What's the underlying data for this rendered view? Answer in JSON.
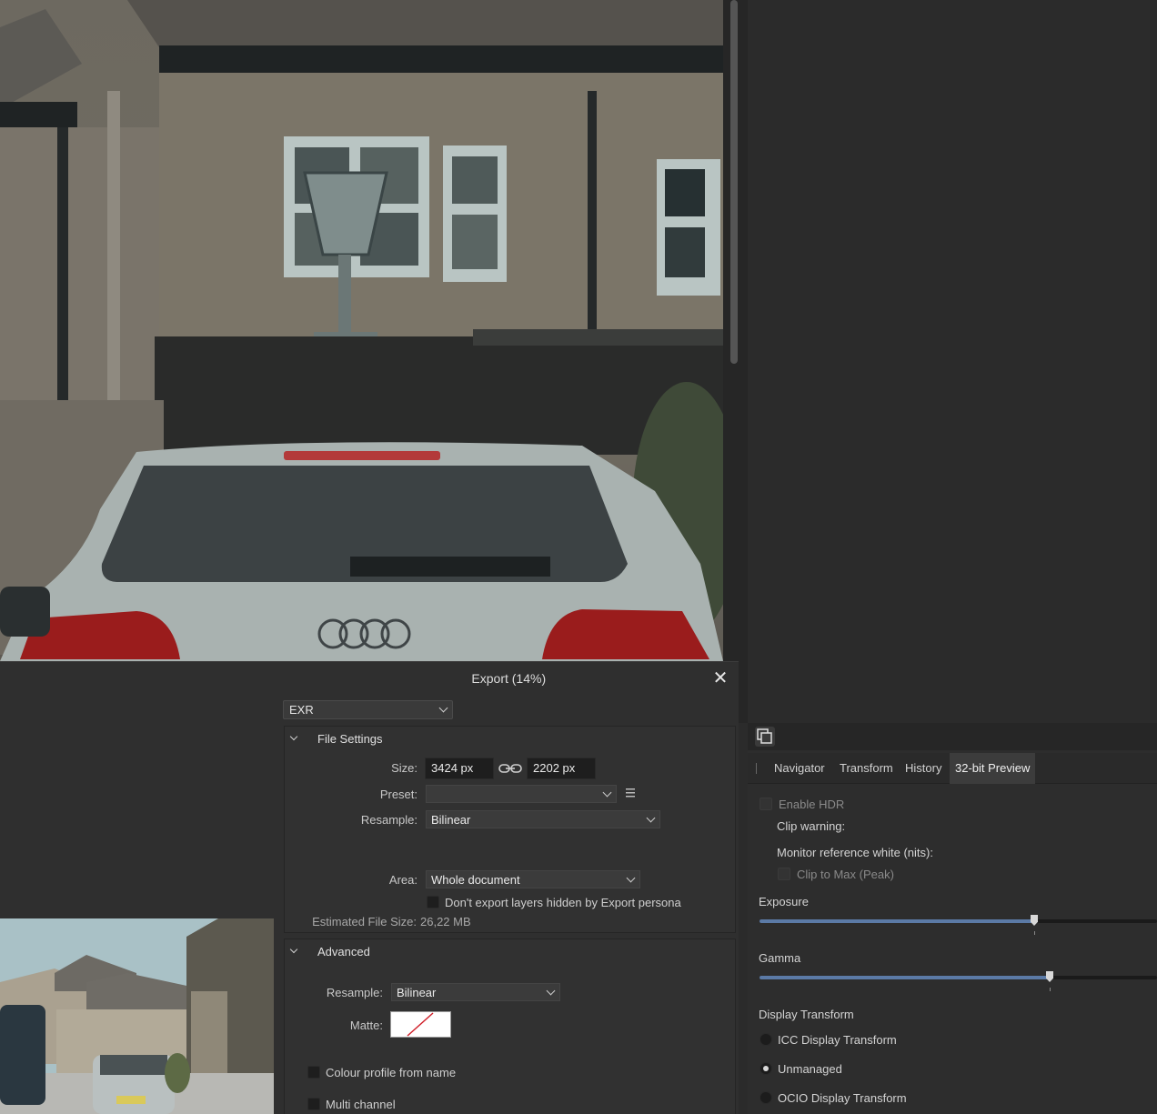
{
  "dialog": {
    "title": "Export (14%)",
    "close_icon": "close-icon",
    "format": "EXR",
    "file_settings": {
      "header": "File Settings",
      "size_label": "Size:",
      "width": "3424 px",
      "height": "2202 px",
      "preset_label": "Preset:",
      "preset_value": "",
      "resample_label": "Resample:",
      "resample_value": "Bilinear",
      "area_label": "Area:",
      "area_value": "Whole document",
      "hidden_layers_label": "Don't export layers hidden by Export persona",
      "estimated_size_label": "Estimated File Size:",
      "estimated_size_value": "26,22 MB"
    },
    "advanced": {
      "header": "Advanced",
      "resample_label": "Resample:",
      "resample_value": "Bilinear",
      "matte_label": "Matte:",
      "colour_profile_label": "Colour profile from name",
      "multi_channel_label": "Multi channel"
    }
  },
  "panel": {
    "tabs": [
      "Navigator",
      "Transform",
      "History",
      "32-bit Preview"
    ],
    "active_tab": "32-bit Preview",
    "enable_hdr": "Enable HDR",
    "clip_warning": "Clip warning:",
    "monitor_ref": "Monitor reference white (nits):",
    "clip_to_max": "Clip to Max (Peak)",
    "exposure_label": "Exposure",
    "exposure_level": 0.69,
    "gamma_label": "Gamma",
    "gamma_level": 0.72,
    "display_transform_label": "Display Transform",
    "options": [
      "ICC Display Transform",
      "Unmanaged",
      "OCIO Display Transform"
    ],
    "selected_option": "Unmanaged"
  },
  "colors": {
    "accent": "#5b7aa6",
    "background": "#2b2b2b",
    "matte_slash": "#d0202a"
  }
}
